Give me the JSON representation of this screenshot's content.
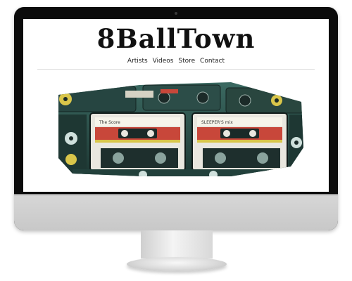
{
  "site": {
    "title": "8BallTown",
    "nav": [
      "Artists",
      "Videos",
      "Store",
      "Contact"
    ]
  },
  "hero": {
    "description_icons": [
      "cassette-icon"
    ],
    "tape_labels": [
      "The Score",
      "SLEEPER'S mix"
    ]
  },
  "colors": {
    "bezel": "#0b0b0b",
    "screen_bg": "#ffffff",
    "chin": "#cfcfcf",
    "cassette_teal": "#2f5b55",
    "cassette_dark": "#1b2a28",
    "label_red": "#c8473a",
    "label_yellow": "#d9c64a"
  }
}
